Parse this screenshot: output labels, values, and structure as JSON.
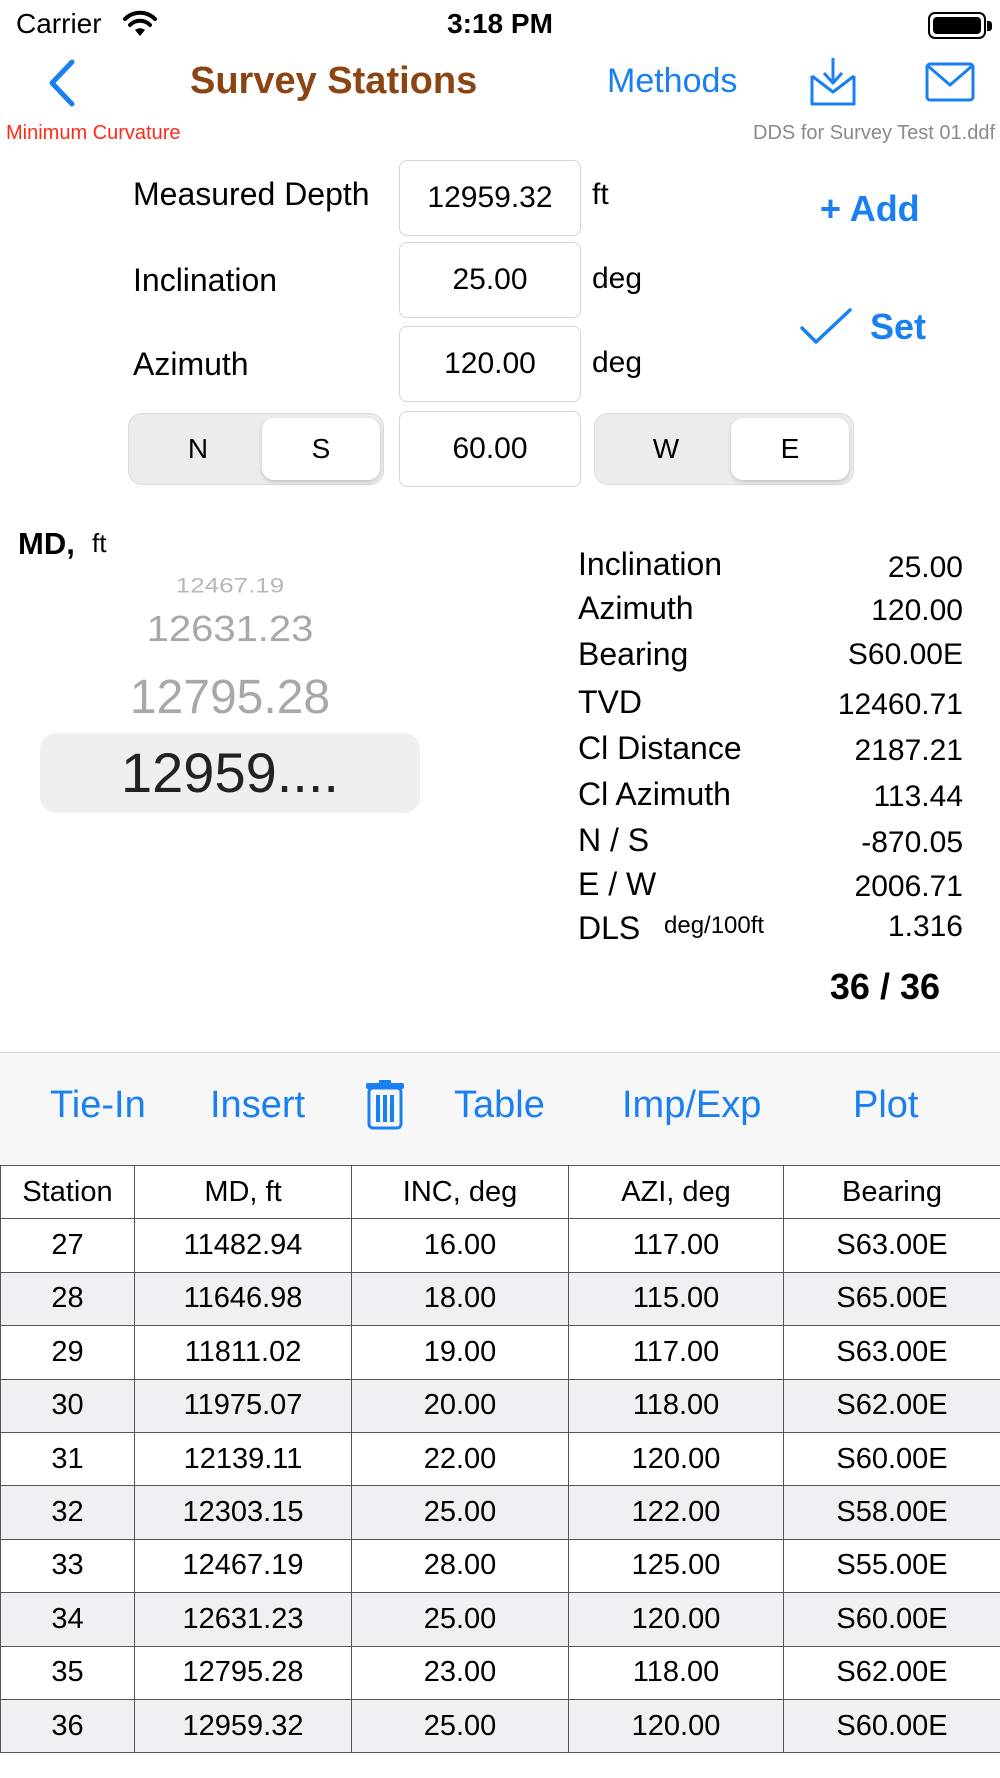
{
  "status_bar": {
    "carrier": "Carrier",
    "time": "3:18 PM"
  },
  "nav": {
    "title": "Survey Stations",
    "methods_label": "Methods",
    "method_name": "Minimum Curvature",
    "file_name": "DDS for Survey Test 01.ddf"
  },
  "form": {
    "md_label": "Measured Depth",
    "md_value": "12959.32",
    "md_unit": "ft",
    "inc_label": "Inclination",
    "inc_value": "25.00",
    "inc_unit": "deg",
    "azi_label": "Azimuth",
    "azi_value": "120.00",
    "azi_unit": "deg",
    "ns_options": [
      "N",
      "S"
    ],
    "ns_selected": "S",
    "bearing_value": "60.00",
    "we_options": [
      "W",
      "E"
    ],
    "we_selected": "E",
    "add_label": "+ Add",
    "set_label": "Set"
  },
  "picker": {
    "label": "MD,",
    "unit": "ft",
    "items": [
      "12467.19",
      "12631.23",
      "12795.28"
    ],
    "selected": "12959...."
  },
  "results": [
    {
      "label": "Inclination",
      "value": "25.00"
    },
    {
      "label": "Azimuth",
      "value": "120.00"
    },
    {
      "label": "Bearing",
      "value": "S60.00E"
    },
    {
      "label": "TVD",
      "value": "12460.71"
    },
    {
      "label": "Cl Distance",
      "value": "2187.21"
    },
    {
      "label": "Cl Azimuth",
      "value": "113.44"
    },
    {
      "label": "N / S",
      "value": "-870.05"
    },
    {
      "label": "E / W",
      "value": "2006.71"
    },
    {
      "label": "DLS",
      "value": "1.316"
    }
  ],
  "dls_unit": "deg/100ft",
  "counter": "36 / 36",
  "toolbar": {
    "tie_in": "Tie-In",
    "insert": "Insert",
    "table": "Table",
    "imp_exp": "Imp/Exp",
    "plot": "Plot"
  },
  "table": {
    "headers": [
      "Station",
      "MD, ft",
      "INC, deg",
      "AZI, deg",
      "Bearing"
    ],
    "rows": [
      [
        "27",
        "11482.94",
        "16.00",
        "117.00",
        "S63.00E"
      ],
      [
        "28",
        "11646.98",
        "18.00",
        "115.00",
        "S65.00E"
      ],
      [
        "29",
        "11811.02",
        "19.00",
        "117.00",
        "S63.00E"
      ],
      [
        "30",
        "11975.07",
        "20.00",
        "118.00",
        "S62.00E"
      ],
      [
        "31",
        "12139.11",
        "22.00",
        "120.00",
        "S60.00E"
      ],
      [
        "32",
        "12303.15",
        "25.00",
        "122.00",
        "S58.00E"
      ],
      [
        "33",
        "12467.19",
        "28.00",
        "125.00",
        "S55.00E"
      ],
      [
        "34",
        "12631.23",
        "25.00",
        "120.00",
        "S60.00E"
      ],
      [
        "35",
        "12795.28",
        "23.00",
        "118.00",
        "S62.00E"
      ],
      [
        "36",
        "12959.32",
        "25.00",
        "120.00",
        "S60.00E"
      ]
    ]
  },
  "colors": {
    "accent": "#1a7ff0",
    "title": "#8b4513",
    "method": "#ff2a1a",
    "file": "#8a8a8a"
  },
  "icons": {
    "back": "chevron-left-icon",
    "download": "tray-download-icon",
    "mail": "envelope-icon",
    "set": "checkmark-icon",
    "delete": "trash-icon",
    "wifi": "wifi-icon",
    "battery": "battery-icon"
  }
}
